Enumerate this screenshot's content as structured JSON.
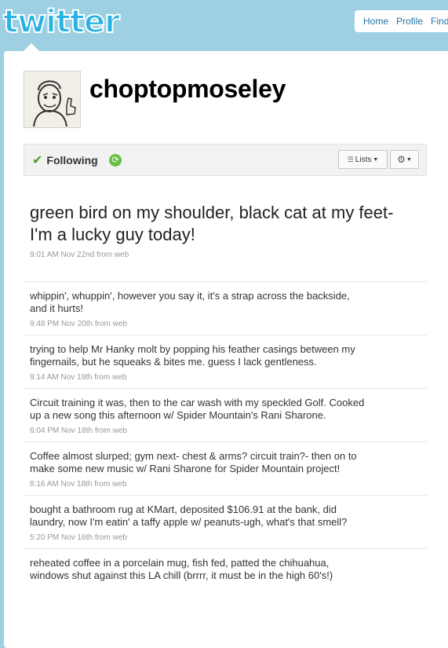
{
  "header": {
    "logo_text": "twitter"
  },
  "topnav": [
    {
      "label": "Home"
    },
    {
      "label": "Profile"
    },
    {
      "label": "Find"
    }
  ],
  "profile": {
    "username": "choptopmoseley",
    "following_label": "Following",
    "lists_label": "Lists"
  },
  "featured_tweet": {
    "text": "green bird on my shoulder, black cat at my feet- I'm a lucky guy today!",
    "meta": "9:01 AM Nov 22nd from web"
  },
  "tweets": [
    {
      "text": "whippin', whuppin', however you say it, it's a strap across the backside, and it hurts!",
      "meta": "9:48 PM Nov 20th from web"
    },
    {
      "text": "trying to help Mr Hanky molt by popping his feather casings between my fingernails, but he squeaks & bites me. guess I lack gentleness.",
      "meta": "9:14 AM Nov 19th from web"
    },
    {
      "text": "Circuit training it was, then to the car wash with my speckled Golf. Cooked up a new song this afternoon w/ Spider Mountain's Rani Sharone.",
      "meta": "6:04 PM Nov 18th from web"
    },
    {
      "text": "Coffee almost slurped; gym next- chest & arms? circuit train?- then on to make some new music w/ Rani Sharone for Spider Mountain project!",
      "meta": "8:16 AM Nov 18th from web"
    },
    {
      "text": "bought a bathroom rug at KMart, deposited $106.91 at the bank, did laundry, now I'm eatin' a taffy apple w/ peanuts-ugh, what's that smell?",
      "meta": "5:20 PM Nov 16th from web"
    },
    {
      "text": "reheated coffee in a porcelain mug, fish fed, patted the chihuahua, windows shut against this LA chill (brrrr, it must be in the high 60's!)",
      "meta": ""
    }
  ]
}
